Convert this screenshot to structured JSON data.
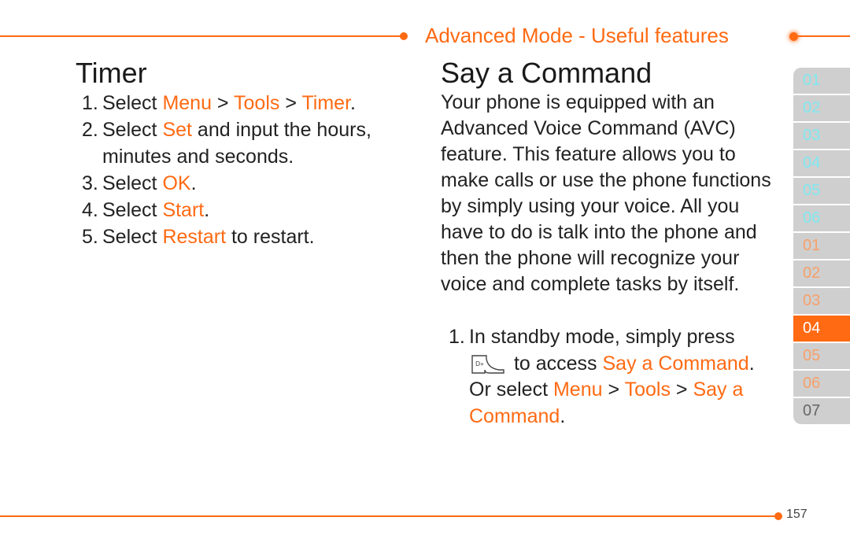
{
  "header": {
    "section_title": "Advanced Mode - Useful features"
  },
  "timer": {
    "title": "Timer",
    "steps": [
      {
        "num": "1.",
        "parts": [
          "Select ",
          "Menu",
          " > ",
          "Tools",
          " > ",
          "Timer",
          "."
        ]
      },
      {
        "num": "2.",
        "parts": [
          "Select ",
          "Set",
          " and input the hours, minutes and seconds."
        ]
      },
      {
        "num": "3.",
        "parts": [
          "Select ",
          "OK",
          "."
        ]
      },
      {
        "num": "4.",
        "parts": [
          "Select ",
          "Start",
          "."
        ]
      },
      {
        "num": "5.",
        "parts": [
          "Select ",
          "Restart",
          " to restart."
        ]
      }
    ]
  },
  "say_command": {
    "title": "Say a Command",
    "intro": "Your phone is equipped with an Advanced Voice Command (AVC) feature. This feature allows you to make calls or use the phone functions by simply using your voice. All you have to do is talk into the phone and then the phone will recognize your voice and complete tasks by itself.",
    "step": {
      "num": "1.",
      "before_icon": "In standby mode, simply press",
      "icon": "voice-key-icon",
      "after_icon": " to access ",
      "hl1": "Say a Command",
      "mid": ". Or select ",
      "hl2": "Menu",
      "sep1": " > ",
      "hl3": "Tools",
      "sep2": " > ",
      "hl4": "Say a Command",
      "end": "."
    }
  },
  "side_tabs": [
    {
      "label": "01",
      "style": "cyan"
    },
    {
      "label": "02",
      "style": "cyan"
    },
    {
      "label": "03",
      "style": "cyan"
    },
    {
      "label": "04",
      "style": "cyan"
    },
    {
      "label": "05",
      "style": "cyan"
    },
    {
      "label": "06",
      "style": "cyan"
    },
    {
      "label": "01",
      "style": "orange"
    },
    {
      "label": "02",
      "style": "orange"
    },
    {
      "label": "03",
      "style": "orange"
    },
    {
      "label": "04",
      "style": "active"
    },
    {
      "label": "05",
      "style": "orange"
    },
    {
      "label": "06",
      "style": "orange"
    },
    {
      "label": "07",
      "style": "gray"
    }
  ],
  "footer": {
    "page_number": "157"
  },
  "colors": {
    "accent": "#ff6a13",
    "tab_bg": "#cfcfcf",
    "tab_cyan": "#7fe8f0",
    "tab_orange": "#f7a06a"
  }
}
